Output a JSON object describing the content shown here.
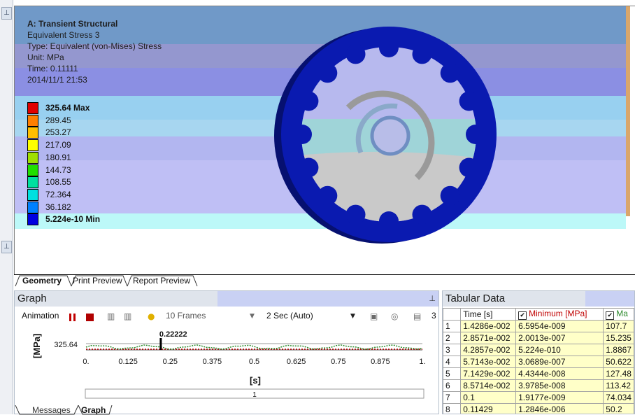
{
  "viewport": {
    "analysis_title": "A: Transient Structural",
    "result_name": "Equivalent Stress 3",
    "type_line": "Type: Equivalent (von-Mises) Stress",
    "unit_line": "Unit: MPa",
    "time_line": "Time: 0.11111",
    "date_line": "2014/11/1 21:53",
    "legend": [
      {
        "label": "325.64 Max",
        "color": "#e00000",
        "bold": true
      },
      {
        "label": "289.45",
        "color": "#ff7f00"
      },
      {
        "label": "253.27",
        "color": "#ffbf00"
      },
      {
        "label": "217.09",
        "color": "#ffff00"
      },
      {
        "label": "180.91",
        "color": "#a0e000"
      },
      {
        "label": "144.73",
        "color": "#20e000"
      },
      {
        "label": "108.55",
        "color": "#00e0a0"
      },
      {
        "label": "72.364",
        "color": "#00e0e0"
      },
      {
        "label": "36.182",
        "color": "#0080ff"
      },
      {
        "label": "5.224e-10 Min",
        "color": "#0000e0",
        "bold": true
      }
    ],
    "background_bands": [
      "#7099c8",
      "#9497cf",
      "#8b8fe3",
      "#98d0f0",
      "#a7d6f0",
      "#b2b6f0",
      "#bfbff5",
      "#bcf8f8"
    ],
    "gear_color": "#0a1ab0"
  },
  "view_tabs": [
    "Geometry",
    "Print Preview",
    "Report Preview"
  ],
  "graph": {
    "title": "Graph",
    "animation_label": "Animation",
    "frames_label": "10 Frames",
    "duration_label": "2 Sec (Auto)",
    "toolbar_end": "3",
    "y_axis_label": "[MPa]",
    "y_tick": "325.64",
    "x_axis_label": "[s]",
    "marker_label": "0.22222",
    "x_ticks": [
      "0.",
      "0.125",
      "0.25",
      "0.375",
      "0.5",
      "0.625",
      "0.75",
      "0.875",
      "1."
    ],
    "scrollbar_label": "1"
  },
  "bottom_tabs": [
    "Messages",
    "Graph"
  ],
  "tabular": {
    "title": "Tabular Data",
    "headers": [
      "Time [s]",
      "Minimum [MPa]",
      "Ma"
    ],
    "rows": [
      [
        "1",
        "1.4286e-002",
        "6.5954e-009",
        "107.7"
      ],
      [
        "2",
        "2.8571e-002",
        "2.0013e-007",
        "15.235"
      ],
      [
        "3",
        "4.2857e-002",
        "5.224e-010",
        "1.8867"
      ],
      [
        "4",
        "5.7143e-002",
        "3.0689e-007",
        "50.622"
      ],
      [
        "5",
        "7.1429e-002",
        "4.4344e-008",
        "127.48"
      ],
      [
        "6",
        "8.5714e-002",
        "3.9785e-008",
        "113.42"
      ],
      [
        "7",
        "0.1",
        "1.9177e-009",
        "74.034"
      ],
      [
        "8",
        "0.11429",
        "1.2846e-006",
        "50.2"
      ]
    ]
  }
}
